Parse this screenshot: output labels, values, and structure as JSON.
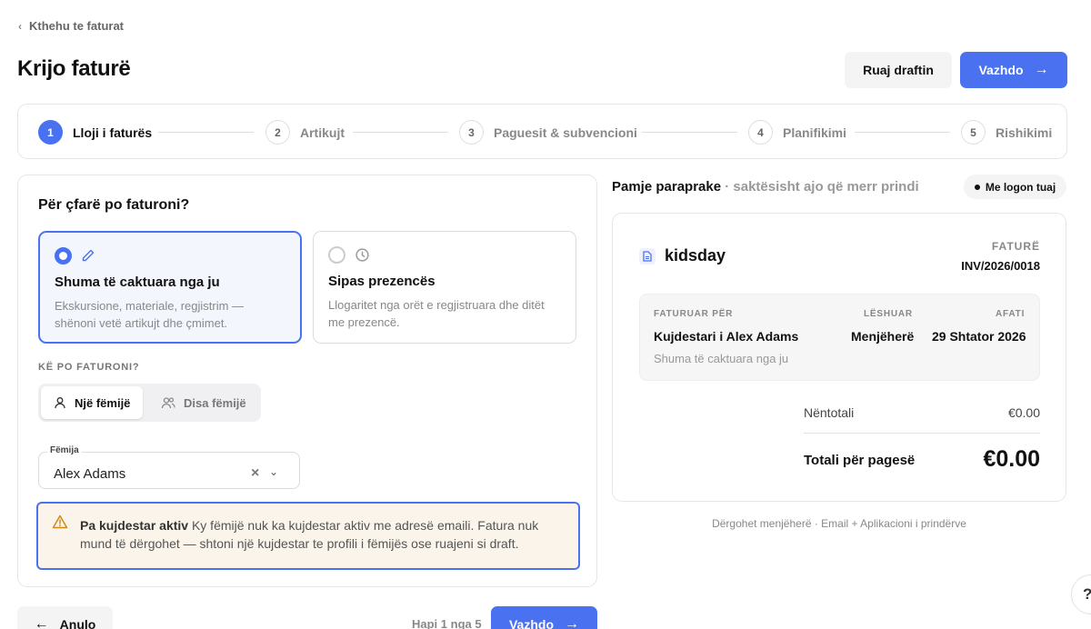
{
  "nav": {
    "back_label": "Kthehu te faturat"
  },
  "header": {
    "title": "Krijo faturë",
    "save_draft_label": "Ruaj draftin",
    "continue_label": "Vazhdo"
  },
  "steps": [
    {
      "num": "1",
      "label": "Lloji i faturës",
      "active": true
    },
    {
      "num": "2",
      "label": "Artikujt",
      "active": false
    },
    {
      "num": "3",
      "label": "Paguesit & subvencioni",
      "active": false
    },
    {
      "num": "4",
      "label": "Planifikimi",
      "active": false
    },
    {
      "num": "5",
      "label": "Rishikimi",
      "active": false
    }
  ],
  "form": {
    "question": "Për çfarë po faturoni?",
    "options": [
      {
        "title": "Shuma të caktuara nga ju",
        "desc": "Ekskursione, materiale, regjistrim — shënoni vetë artikujt dhe çmimet.",
        "selected": true
      },
      {
        "title": "Sipas prezencës",
        "desc": "Llogaritet nga orët e regjistruara dhe ditët me prezencë.",
        "selected": false
      }
    ],
    "who_label": "KË PO FATURONI?",
    "segments": [
      {
        "label": "Një fëmijë",
        "selected": true
      },
      {
        "label": "Disa fëmijë",
        "selected": false
      }
    ],
    "child_field": {
      "label": "Fëmija",
      "value": "Alex Adams"
    },
    "warning": {
      "title": "Pa kujdestar aktiv",
      "text": " Ky fëmijë nuk ka kujdestar aktiv me adresë emaili. Fatura nuk mund të dërgohet — shtoni një kujdestar te profili i fëmijës ose ruajeni si draft."
    },
    "cancel_label": "Anulo",
    "step_count": "Hapi 1 nga 5",
    "continue_label": "Vazhdo"
  },
  "preview": {
    "title": "Pamje paraprake",
    "subtitle": " · saktësisht ajo që merr prindi",
    "logo_chip": "Me logon tuaj",
    "brand": "kidsday",
    "invoice_label": "FATURË",
    "invoice_number": "INV/2026/0018",
    "billed_to_label": "FATURUAR PËR",
    "billed_to": "Kujdestari i Alex Adams",
    "billed_sub": "Shuma të caktuara nga ju",
    "issued_label": "LËSHUAR",
    "issued": "Menjëherë",
    "due_label": "AFATI",
    "due": "29 Shtator 2026",
    "subtotal_label": "Nëntotali",
    "subtotal": "€0.00",
    "total_label": "Totali për pagesë",
    "total": "€0.00",
    "footer": "Dërgohet menjëherë · Email + Aplikacioni i prindërve"
  },
  "help": {
    "label": "?"
  },
  "colors": {
    "accent": "#4a72f0",
    "warning_bg": "#fbf4ea",
    "warning_icon": "#d08a1c"
  }
}
